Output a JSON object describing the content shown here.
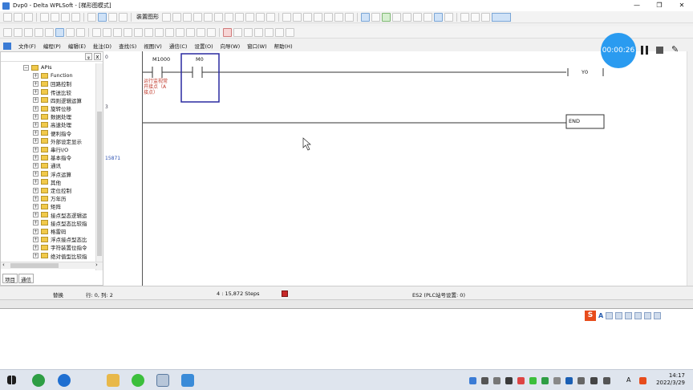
{
  "window": {
    "title": "Dvp0 - Delta WPLSoft - [梯形图模式]",
    "min_glyph": "—",
    "restore_glyph": "❐",
    "close_glyph": "✕"
  },
  "toolbar1": {
    "ladder_label": "装置图形"
  },
  "menu": {
    "items": [
      "文件(F)",
      "编程(P)",
      "编辑(E)",
      "批注(D)",
      "查找(S)",
      "视图(V)",
      "通信(C)",
      "设置(O)",
      "向导(W)",
      "窗口(W)",
      "帮助(H)"
    ]
  },
  "left_panel": {
    "pin_glyph": "ᵩ",
    "close_glyph": "x",
    "root_label": "APIs",
    "items": [
      "Function",
      "回路控制",
      "传送比较",
      "四则逻辑运算",
      "旋转位移",
      "数据处理",
      "高速处理",
      "便利指令",
      "外部设定显示",
      "串行I/O",
      "基本指令",
      "通讯",
      "浮点运算",
      "其他",
      "定位控制",
      "万年历",
      "矩阵",
      "接点型态逻辑运",
      "接点型态比较指",
      "格雷码",
      "浮点接点型态比",
      "字符装置位指令",
      "绝对值型比较指"
    ],
    "tabs": [
      "项目",
      "通信"
    ],
    "hscroll_left": "‹",
    "hscroll_right": "›"
  },
  "gutter": {
    "row0": "0",
    "row1": "3",
    "steps": "15871"
  },
  "ladder": {
    "contact1_label": "M1000",
    "contact2_label": "M0",
    "comment": [
      "运行监视常",
      "开接点（A",
      "接点）"
    ],
    "coil_label": "Y0",
    "end_label": "END"
  },
  "status": {
    "mode": "替换",
    "position": "行: 0, 列: 2",
    "steps": "4 : 15,872 Steps",
    "plc": "ES2 (PLC站号设置: 0)"
  },
  "recorder": {
    "time": "00:00:26",
    "pen_glyph": "✎"
  },
  "ime": {
    "logo": "S",
    "mode": "A"
  },
  "tray": {
    "lang": "A",
    "time": "14:17",
    "date": "2022/3/29"
  },
  "colors": {
    "recorder": "#2a9bf0",
    "comment": "#c0392b",
    "selection": "#2a2aa0",
    "stop": "#c62828"
  }
}
